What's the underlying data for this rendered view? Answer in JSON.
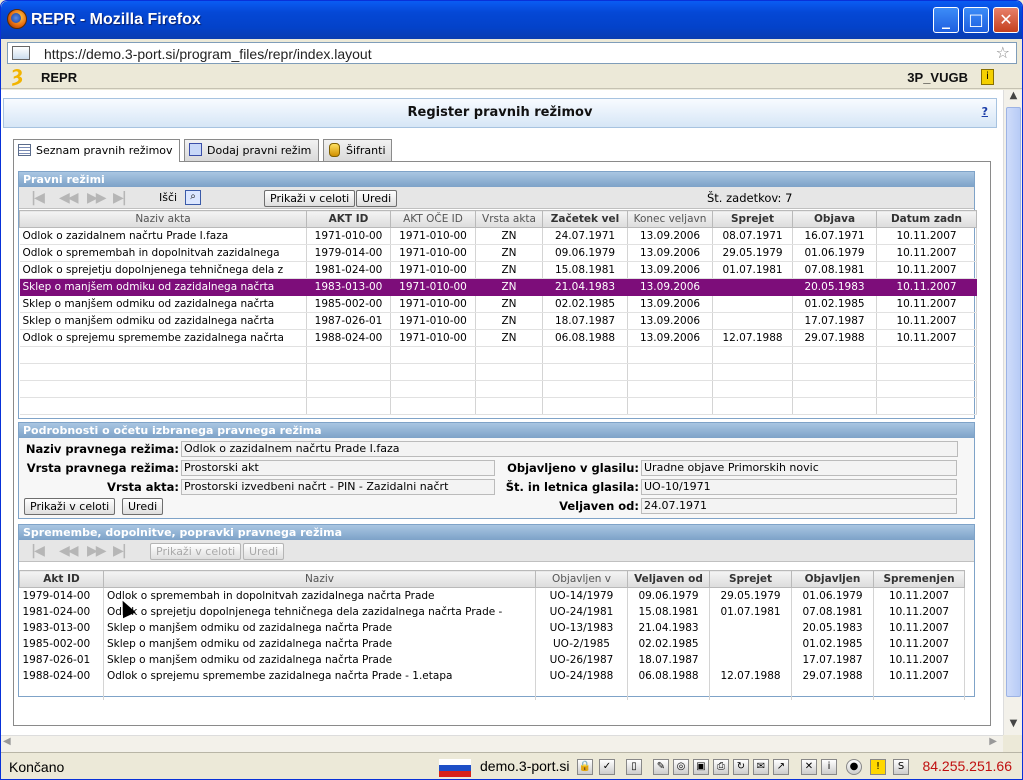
{
  "window": {
    "title": "REPR - Mozilla Firefox",
    "url": "https://demo.3-port.si/program_files/repr/index.layout"
  },
  "app": {
    "name": "REPR",
    "user": "3P_VUGB"
  },
  "header": {
    "title": "Register pravnih režimov",
    "help": "?"
  },
  "tabs": [
    {
      "label": "Seznam pravnih režimov"
    },
    {
      "label": "Dodaj pravni režim"
    },
    {
      "label": "Šifranti"
    }
  ],
  "panel1": {
    "title": "Pravni režimi",
    "search_label": "Išči",
    "show_all": "Prikaži v celoti",
    "edit": "Uredi",
    "count_label": "Št. zadetkov: 7",
    "columns": [
      "Naziv akta",
      "AKT ID",
      "AKT OČE ID",
      "Vrsta akta",
      "Začetek vel",
      "Konec veljavn",
      "Sprejet",
      "Objava",
      "Datum zadn"
    ],
    "rows": [
      [
        "Odlok o zazidalnem načrtu Prade I.faza",
        "1971-010-00",
        "1971-010-00",
        "ZN",
        "24.07.1971",
        "13.09.2006",
        "08.07.1971",
        "16.07.1971",
        "10.11.2007"
      ],
      [
        "Odlok o spremembah in dopolnitvah zazidalnega",
        "1979-014-00",
        "1971-010-00",
        "ZN",
        "09.06.1979",
        "13.09.2006",
        "29.05.1979",
        "01.06.1979",
        "10.11.2007"
      ],
      [
        "Odlok o sprejetju dopolnjenega tehničnega dela z",
        "1981-024-00",
        "1971-010-00",
        "ZN",
        "15.08.1981",
        "13.09.2006",
        "01.07.1981",
        "07.08.1981",
        "10.11.2007"
      ],
      [
        "Sklep  o manjšem odmiku od zazidalnega načrta",
        "1983-013-00",
        "1971-010-00",
        "ZN",
        "21.04.1983",
        "13.09.2006",
        "",
        "20.05.1983",
        "10.11.2007"
      ],
      [
        "Sklep  o manjšem odmiku od zazidalnega načrta",
        "1985-002-00",
        "1971-010-00",
        "ZN",
        "02.02.1985",
        "13.09.2006",
        "",
        "01.02.1985",
        "10.11.2007"
      ],
      [
        "Sklep  o manjšem odmiku od zazidalnega načrta",
        "1987-026-01",
        "1971-010-00",
        "ZN",
        "18.07.1987",
        "13.09.2006",
        "",
        "17.07.1987",
        "10.11.2007"
      ],
      [
        "Odlok o sprejemu spremembe zazidalnega načrta",
        "1988-024-00",
        "1971-010-00",
        "ZN",
        "06.08.1988",
        "13.09.2006",
        "12.07.1988",
        "29.07.1988",
        "10.11.2007"
      ]
    ]
  },
  "panel2": {
    "title": "Podrobnosti o očetu izbranega pravnega režima",
    "naziv_label": "Naziv pravnega režima:",
    "naziv": "Odlok o zazidalnem načrtu Prade I.faza",
    "vrsta_rezima_label": "Vrsta pravnega režima:",
    "vrsta_rezima": "Prostorski akt",
    "vrsta_akta_label": "Vrsta akta:",
    "vrsta_akta": "Prostorski izvedbeni načrt - PIN - Zazidalni načrt",
    "glasilo_label": "Objavljeno v glasilu:",
    "glasilo": "Uradne objave Primorskih novic",
    "letnica_label": "Št. in letnica glasila:",
    "letnica": "UO-10/1971",
    "veljaven_label": "Veljaven od:",
    "veljaven": "24.07.1971",
    "show_all": "Prikaži v celoti",
    "edit": "Uredi"
  },
  "panel3": {
    "title": "Spremembe, dopolnitve, popravki pravnega režima",
    "show_all": "Prikaži v celoti",
    "edit": "Uredi",
    "columns": [
      "Akt ID",
      "Naziv",
      "Objavljen v",
      "Veljaven od",
      "Sprejet",
      "Objavljen",
      "Spremenjen"
    ],
    "rows": [
      [
        "1979-014-00",
        "Odlok o spremembah in dopolnitvah zazidalnega načrta Prade",
        "UO-14/1979",
        "09.06.1979",
        "29.05.1979",
        "01.06.1979",
        "10.11.2007"
      ],
      [
        "1981-024-00",
        "Odlok o sprejetju dopolnjenega tehničnega dela zazidalnega načrta Prade -",
        "UO-24/1981",
        "15.08.1981",
        "01.07.1981",
        "07.08.1981",
        "10.11.2007"
      ],
      [
        "1983-013-00",
        "Sklep  o manjšem odmiku od zazidalnega načrta Prade",
        "UO-13/1983",
        "21.04.1983",
        "",
        "20.05.1983",
        "10.11.2007"
      ],
      [
        "1985-002-00",
        "Sklep  o manjšem odmiku od zazidalnega načrta Prade",
        "UO-2/1985",
        "02.02.1985",
        "",
        "01.02.1985",
        "10.11.2007"
      ],
      [
        "1987-026-01",
        "Sklep  o manjšem odmiku od zazidalnega načrta Prade",
        "UO-26/1987",
        "18.07.1987",
        "",
        "17.07.1987",
        "10.11.2007"
      ],
      [
        "1988-024-00",
        "Odlok o sprejemu spremembe zazidalnega načrta Prade - 1.etapa",
        "UO-24/1988",
        "06.08.1988",
        "12.07.1988",
        "29.07.1988",
        "10.11.2007"
      ]
    ]
  },
  "status": {
    "text": "Končano",
    "site": "demo.3-port.si",
    "ip": "84.255.251.66"
  },
  "colors": {
    "selected_row": "#7d0d7a",
    "panel_title": "#7da2c8",
    "ip": "#c01010"
  }
}
